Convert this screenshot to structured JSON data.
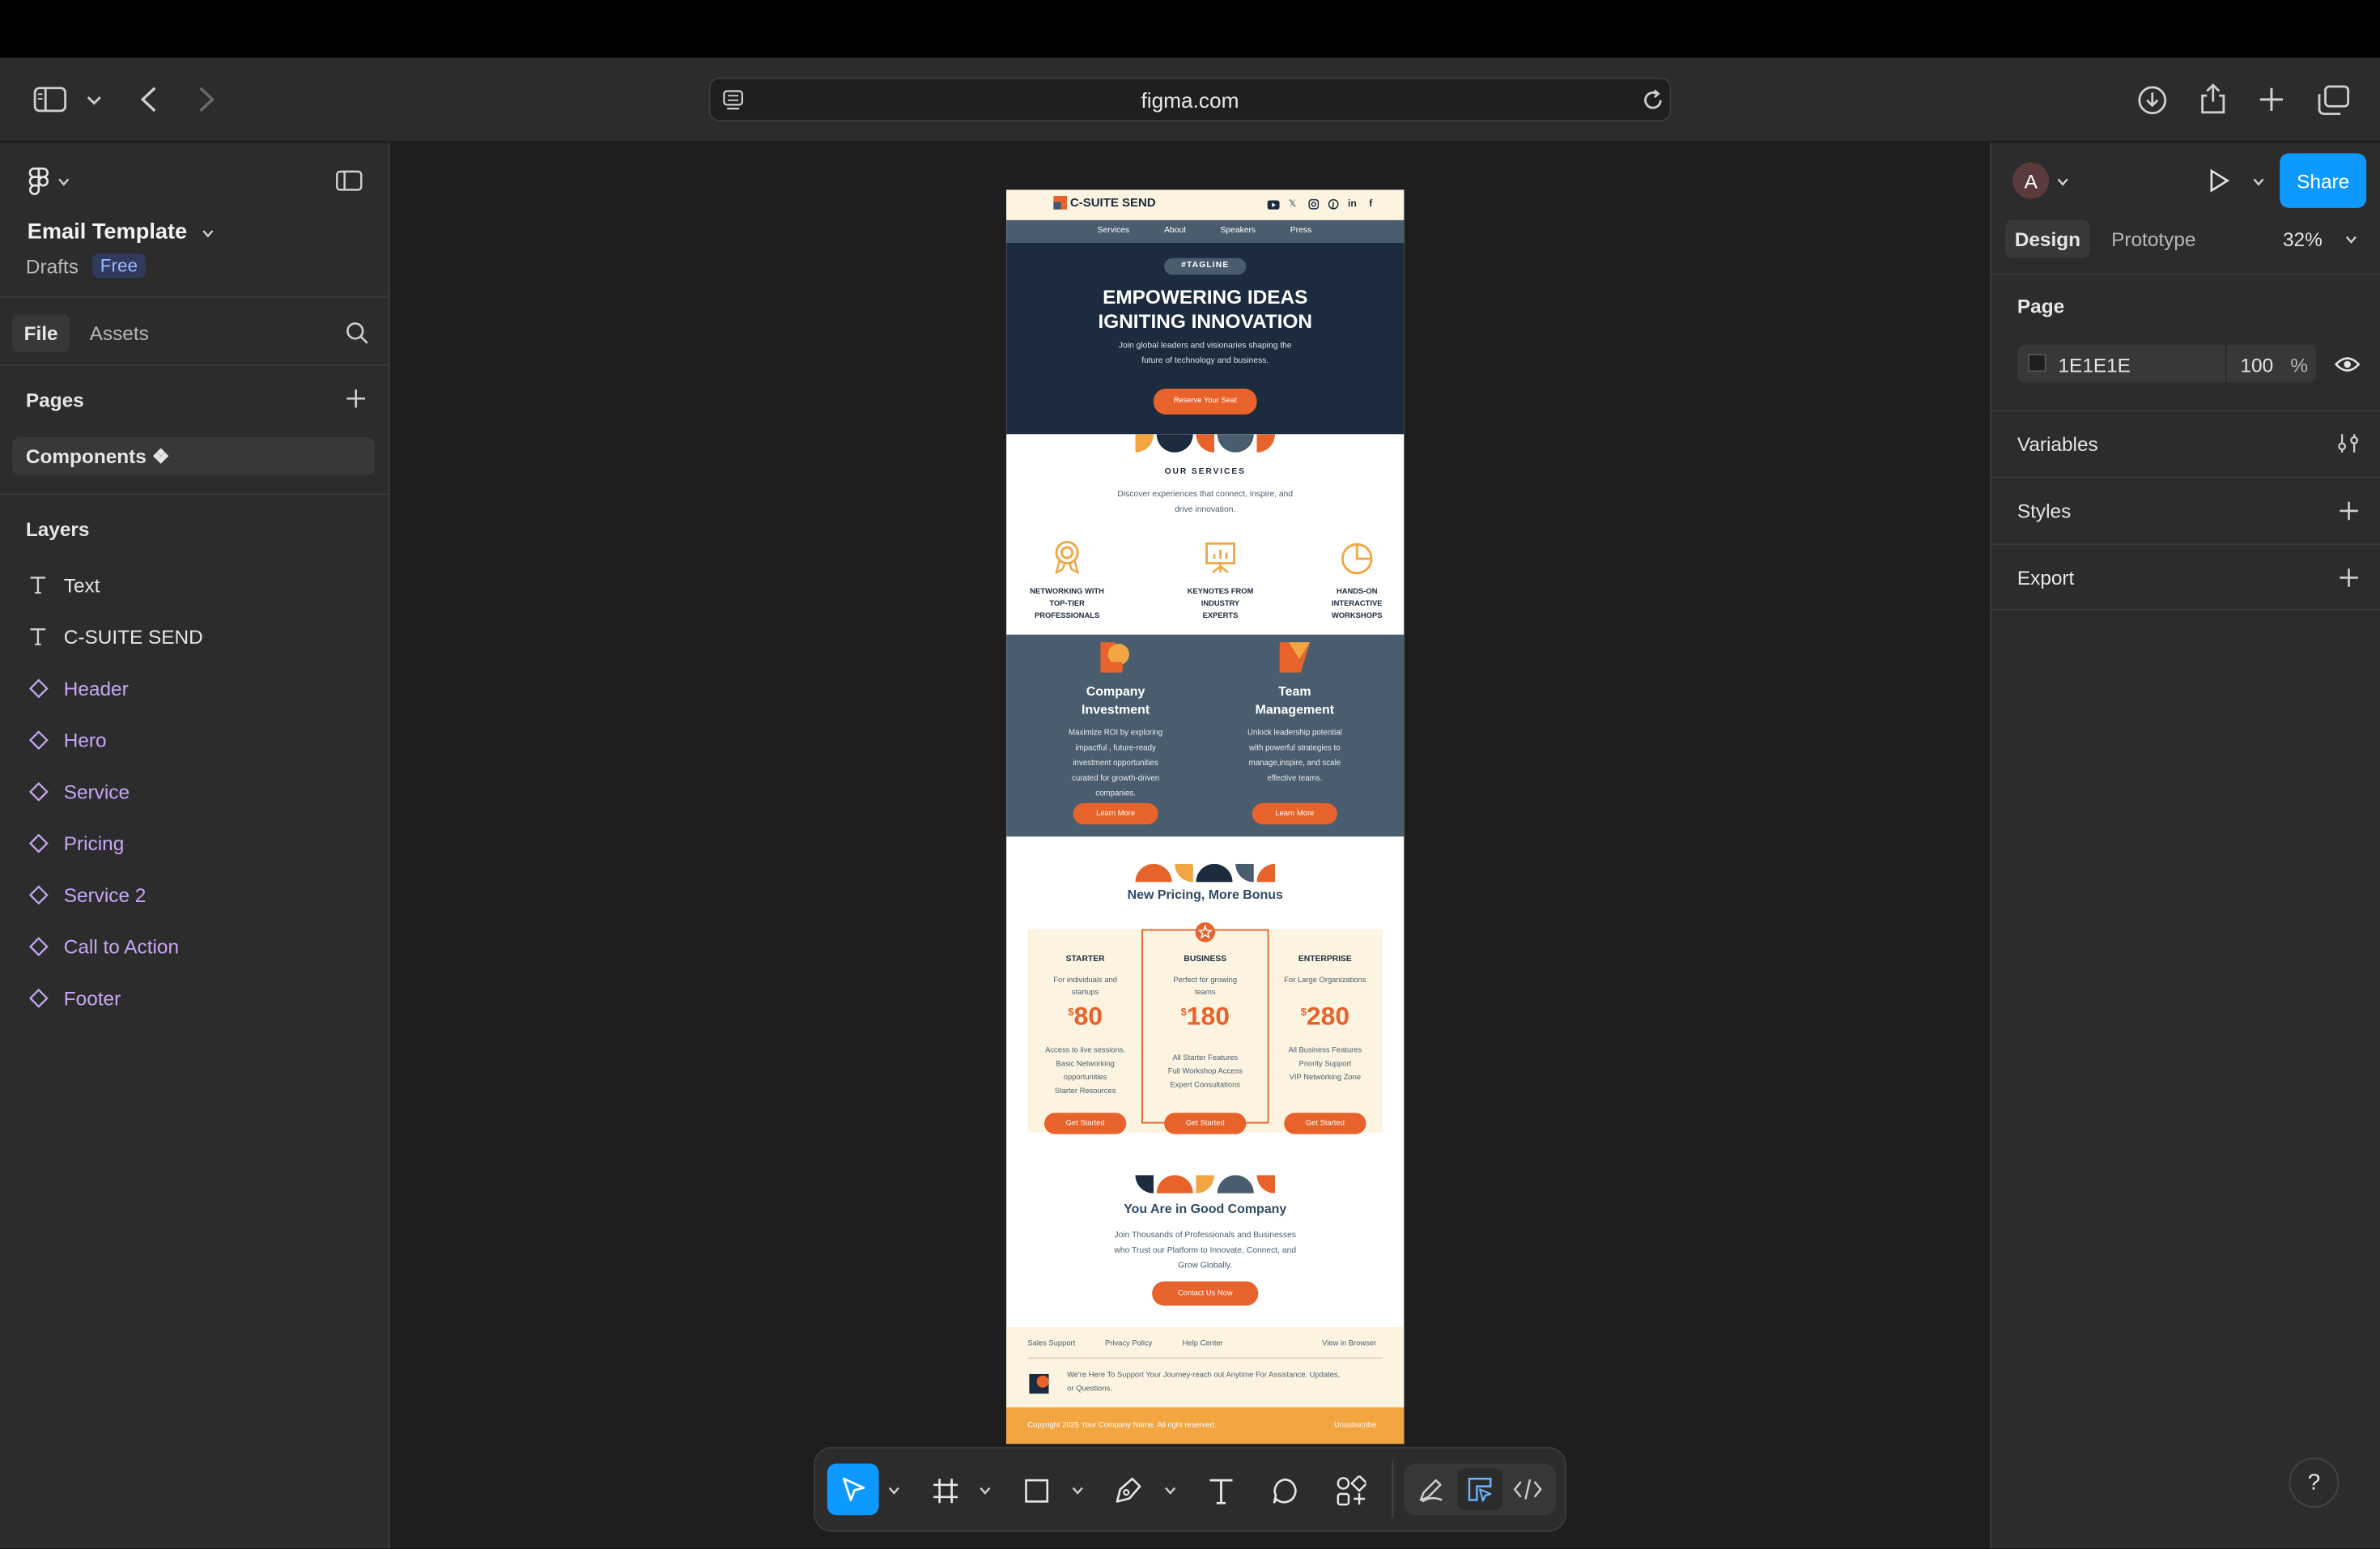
{
  "browser": {
    "url": "figma.com"
  },
  "left_panel": {
    "file_name": "Email Template",
    "location": "Drafts",
    "plan_badge": "Free",
    "tabs": [
      "File",
      "Assets"
    ],
    "pages_heading": "Pages",
    "current_page": "Components ❖",
    "layers_heading": "Layers",
    "layers": [
      {
        "type": "text",
        "label": "Text"
      },
      {
        "type": "text",
        "label": "C-SUITE SEND"
      },
      {
        "type": "component",
        "label": "Header"
      },
      {
        "type": "component",
        "label": "Hero"
      },
      {
        "type": "component",
        "label": "Service"
      },
      {
        "type": "component",
        "label": "Pricing"
      },
      {
        "type": "component",
        "label": "Service 2"
      },
      {
        "type": "component",
        "label": "Call to Action"
      },
      {
        "type": "component",
        "label": "Footer"
      }
    ]
  },
  "right_panel": {
    "avatar_letter": "A",
    "share_label": "Share",
    "tabs": [
      "Design",
      "Prototype"
    ],
    "zoom": "32%",
    "page_heading": "Page",
    "bg_color": "1E1E1E",
    "bg_opacity": "100",
    "opacity_unit": "%",
    "sections": [
      "Variables",
      "Styles",
      "Export"
    ]
  },
  "help_label": "?",
  "email": {
    "logo_text": "C-SUITE SEND",
    "nav": [
      "Services",
      "About",
      "Speakers",
      "Press"
    ],
    "social_x": "𝕏",
    "social_in": "in",
    "social_f": "f",
    "tagline": "#TAGLINE",
    "hero_title_1": "EMPOWERING IDEAS",
    "hero_title_2": "IGNITING INNOVATION",
    "hero_sub_1": "Join global leaders and visionaries shaping the",
    "hero_sub_2": "future of technology and business.",
    "hero_cta": "Reserve Your Seat",
    "services_heading": "OUR SERVICES",
    "services_sub_1": "Discover experiences that connect, inspire, and",
    "services_sub_2": "drive innovation.",
    "service_items": [
      {
        "l1": "NETWORKING WITH",
        "l2": "TOP-TIER",
        "l3": "PROFESSIONALS"
      },
      {
        "l1": "KEYNOTES FROM",
        "l2": "INDUSTRY",
        "l3": "EXPERTS"
      },
      {
        "l1": "HANDS-ON",
        "l2": "INTERACTIVE",
        "l3": "WORKSHOPS"
      }
    ],
    "features": [
      {
        "t1": "Company",
        "t2": "Investment",
        "d": [
          "Maximize ROI by exploring",
          "impactful , future-ready",
          "investment opportunities",
          "curated for growth-driven",
          "companies."
        ],
        "cta": "Learn More"
      },
      {
        "t1": "Team",
        "t2": "Management",
        "d": [
          "Unlock leadership potential",
          "with powerful strategies to",
          "manage,inspire, and scale",
          "effective teams."
        ],
        "cta": "Learn More"
      }
    ],
    "pricing_heading": "New Pricing, More Bonus",
    "plans": [
      {
        "name": "STARTER",
        "s1": "For individuals and",
        "s2": "startups",
        "currency": "$",
        "price": "80",
        "f": [
          "Access to live sessions.",
          "Basic Networking",
          "opportunities",
          "Starter Resources"
        ],
        "cta": "Get Started"
      },
      {
        "name": "BUSINESS",
        "s1": "Perfect for growing",
        "s2": "teams",
        "currency": "$",
        "price": "180",
        "f": [
          "All Starter Features",
          "Full Workshop Access",
          "Expert Consultations"
        ],
        "cta": "Get Started"
      },
      {
        "name": "ENTERPRISE",
        "s1": "For Large Organizations",
        "s2": "",
        "currency": "$",
        "price": "280",
        "f": [
          "All Business Features",
          "Priority Support",
          "VIP Networking Zone"
        ],
        "cta": "Get Started"
      }
    ],
    "company_heading": "You Are in Good Company",
    "company_sub_1": "Join Thousands of Professionals and Businesses",
    "company_sub_2": "who Trust our Platform to Innovate, Connect, and",
    "company_sub_3": "Grow Globally.",
    "company_cta": "Contact Us Now",
    "footer_links": [
      "Sales Support",
      "Privacy Policy",
      "Help Center"
    ],
    "footer_view": "View in Browser",
    "footer_msg_1": "We're Here To Support Your Journey-reach out Anytime For Assistance, Updates,",
    "footer_msg_2": "or Questions.",
    "copyright": "Copyright 2025 Your Company Name. All right reserved.",
    "unsubscribe": "Unsubscribe"
  },
  "colors": {
    "canvas": "#1e1e1e",
    "panel": "#2c2c2c",
    "accent": "#0d99ff",
    "brand_orange": "#e8632b",
    "navy": "#1c2b3d",
    "slate": "#4a5d6e",
    "cream": "#fdf3e1"
  },
  "icons": [
    "sidebar-toggle-icon",
    "back-icon",
    "forward-icon",
    "reload-icon",
    "download-icon",
    "share-icon",
    "new-tab-icon",
    "tabs-icon",
    "figma-logo-icon",
    "search-icon",
    "plus-icon",
    "text-layer-icon",
    "component-icon",
    "play-icon",
    "eye-icon",
    "move-tool-icon",
    "frame-tool-icon",
    "shape-tool-icon",
    "pen-tool-icon",
    "text-tool-icon",
    "comment-tool-icon",
    "actions-icon",
    "draw-mode-icon",
    "design-mode-icon",
    "dev-mode-icon"
  ]
}
